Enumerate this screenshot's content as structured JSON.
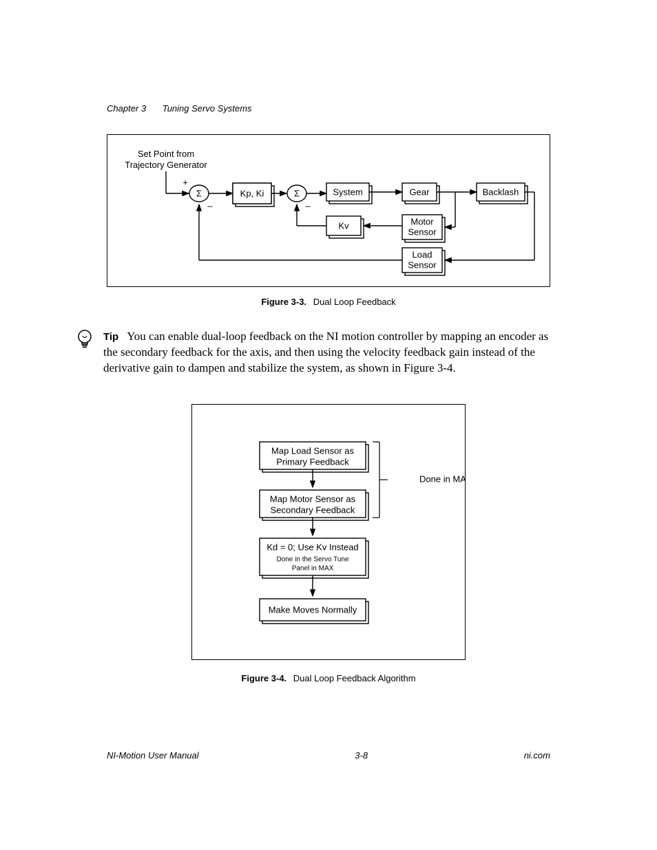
{
  "header": {
    "chapter": "Chapter 3",
    "section": "Tuning Servo Systems"
  },
  "fig1": {
    "setpoint_l1": "Set Point from",
    "setpoint_l2": "Trajectory Generator",
    "plus1": "+",
    "minus1": "–",
    "minus2": "–",
    "sigma1": "Σ",
    "sigma2": "Σ",
    "kpki": "Kp, Ki",
    "system": "System",
    "gear": "Gear",
    "backlash": "Backlash",
    "kv": "Kv",
    "motor_l1": "Motor",
    "motor_l2": "Sensor",
    "load_l1": "Load",
    "load_l2": "Sensor",
    "caption_label": "Figure 3-3.",
    "caption_text": "Dual Loop Feedback"
  },
  "tip": {
    "label": "Tip",
    "text": "You can enable dual-loop feedback on the NI motion controller by mapping an encoder as the secondary feedback for the axis, and then using the velocity feedback gain instead of the derivative gain to dampen and stabilize the system, as shown in Figure 3-4."
  },
  "fig2": {
    "step1_l1": "Map Load Sensor as",
    "step1_l2": "Primary Feedback",
    "step2_l1": "Map Motor Sensor as",
    "step2_l2": "Secondary Feedback",
    "step3_l1": "Kd = 0; Use Kv Instead",
    "step3_sub_l1": "Done in the Servo Tune",
    "step3_sub_l2": "Panel in MAX",
    "step4": "Make Moves Normally",
    "side": "Done in MAX",
    "caption_label": "Figure 3-4.",
    "caption_text": "Dual Loop Feedback Algorithm"
  },
  "footer": {
    "left": "NI-Motion User Manual",
    "center": "3-8",
    "right": "ni.com"
  }
}
